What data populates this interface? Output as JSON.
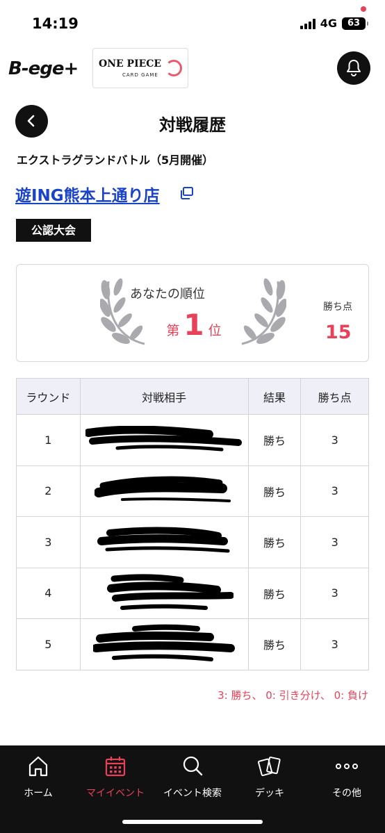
{
  "status_bar": {
    "time": "14:19",
    "network": "4G",
    "battery": "63"
  },
  "header": {
    "brand_logo": "B-ege+",
    "game_logo_title": "ONE PIECE",
    "game_logo_subtitle": "CARD GAME"
  },
  "page": {
    "title": "対戦履歴",
    "event_name": "エクストラグランドバトル（5月開催）",
    "store_name": "遊ING熊本上通り店",
    "tag": "公認大会"
  },
  "rank_card": {
    "label": "あなたの順位",
    "prefix": "第",
    "rank": "1",
    "suffix": "位",
    "points_label": "勝ち点",
    "points_value": "15"
  },
  "table": {
    "headers": {
      "round": "ラウンド",
      "opponent": "対戦相手",
      "result": "結果",
      "points": "勝ち点"
    },
    "rows": [
      {
        "round": "1",
        "result": "勝ち",
        "points": "3"
      },
      {
        "round": "2",
        "result": "勝ち",
        "points": "3"
      },
      {
        "round": "3",
        "result": "勝ち",
        "points": "3"
      },
      {
        "round": "4",
        "result": "勝ち",
        "points": "3"
      },
      {
        "round": "5",
        "result": "勝ち",
        "points": "3"
      }
    ]
  },
  "legend": "3: 勝ち、 0: 引き分け、 0: 負け",
  "bottom_nav": [
    {
      "label": "ホーム",
      "icon": "home-icon"
    },
    {
      "label": "マイイベント",
      "icon": "calendar-icon",
      "active": true
    },
    {
      "label": "イベント検索",
      "icon": "search-icon"
    },
    {
      "label": "デッキ",
      "icon": "cards-icon"
    },
    {
      "label": "その他",
      "icon": "more-icon"
    }
  ],
  "colors": {
    "accent": "#e8425a",
    "link": "#1a44c8",
    "dark": "#111111",
    "table_header": "#efeff7"
  }
}
